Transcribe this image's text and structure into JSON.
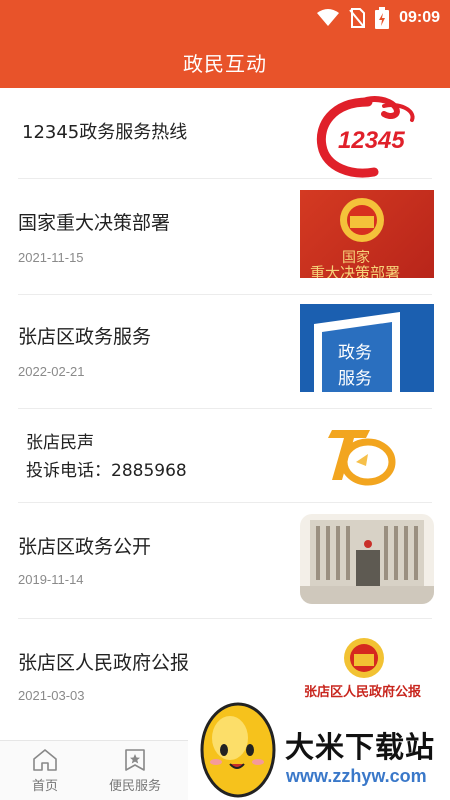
{
  "status_bar": {
    "time": "09:09",
    "icons": [
      "wifi-icon",
      "no-sim-icon",
      "battery-charging-icon"
    ]
  },
  "app_bar": {
    "title": "政民互动"
  },
  "items": [
    {
      "title": "12345政务服务热线",
      "date": "",
      "logo_text": "12345"
    },
    {
      "title": "国家重大决策部署",
      "date": "2021-11-15",
      "thumb_text": "国家 重大决策部署"
    },
    {
      "title": "张店区政务服务",
      "date": "2022-02-21",
      "thumb_text": "政务服务"
    },
    {
      "title": "张店民声",
      "subtitle": "投诉电话：2885968",
      "date": ""
    },
    {
      "title": "张店区政务公开",
      "date": "2019-11-14"
    },
    {
      "title": "张店区人民政府公报",
      "date": "2021-03-03",
      "thumb_text": "张店区人民政府公报"
    }
  ],
  "bottom_nav": [
    {
      "label": "首页",
      "icon": "home-icon"
    },
    {
      "label": "便民服务",
      "icon": "bookmark-star-icon"
    }
  ],
  "watermark": {
    "text": "大米下载站",
    "url": "www.zzhyw.com"
  },
  "colors": {
    "primary": "#e8532a",
    "text": "#222222",
    "date": "#8a8a8a",
    "watermark_url": "#3a78c9"
  }
}
